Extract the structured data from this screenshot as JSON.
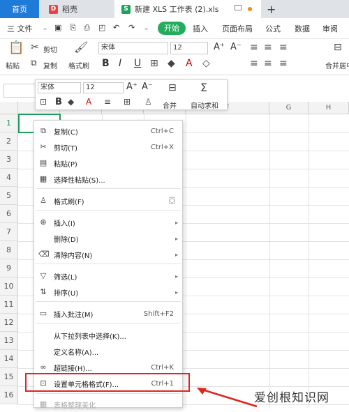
{
  "tabs": {
    "home": "首页",
    "daoke": "稻壳",
    "file": "新建 XLS 工作表 (2).xls",
    "add": "+"
  },
  "menubar": {
    "file": "三 文件",
    "start": "开始",
    "insert": "插入",
    "layout": "页面布局",
    "formula": "公式",
    "data": "数据",
    "review": "审阅"
  },
  "toolbar": {
    "cut": "剪切",
    "paste": "粘贴",
    "copy": "复制",
    "format_painter": "格式刷",
    "font_name": "宋体",
    "font_size": "12",
    "grow": "A⁺",
    "shrink": "A⁻",
    "bold": "B",
    "italic": "I",
    "underline": "U",
    "merge": "合并居中"
  },
  "mini_toolbar": {
    "font_name": "宋体",
    "font_size": "12",
    "merge": "合并",
    "autosum": "自动求和"
  },
  "columns": [
    "",
    "",
    "",
    "",
    "F",
    "G",
    "H"
  ],
  "rows": [
    "1",
    "2",
    "3",
    "4",
    "5",
    "6",
    "7",
    "8",
    "9",
    "10",
    "11",
    "12",
    "13",
    "14",
    "15",
    "16"
  ],
  "context_menu": {
    "copy": {
      "label": "复制(C)",
      "shortcut": "Ctrl+C"
    },
    "cut": {
      "label": "剪切(T)",
      "shortcut": "Ctrl+X"
    },
    "paste": {
      "label": "粘贴(P)"
    },
    "paste_special": {
      "label": "选择性粘贴(S)..."
    },
    "format_painter": {
      "label": "格式刷(F)"
    },
    "insert": {
      "label": "插入(I)"
    },
    "delete": {
      "label": "删除(D)"
    },
    "clear": {
      "label": "清除内容(N)"
    },
    "filter": {
      "label": "筛选(L)"
    },
    "sort": {
      "label": "排序(U)"
    },
    "insert_comment": {
      "label": "插入批注(M)",
      "shortcut": "Shift+F2"
    },
    "pick_list": {
      "label": "从下拉列表中选择(K)..."
    },
    "define_name": {
      "label": "定义名称(A)..."
    },
    "hyperlink": {
      "label": "超链接(H)...",
      "shortcut": "Ctrl+K"
    },
    "format_cells": {
      "label": "设置单元格格式(F)...",
      "shortcut": "Ctrl+1"
    },
    "beautify": {
      "label": "表格整理美化"
    }
  },
  "watermark": "爱创根知识网",
  "colors": {
    "accent_blue": "#1f7bd8",
    "start_green": "#22ad5c",
    "highlight_red": "#e0251f",
    "selection_green": "#1e9e5a"
  }
}
